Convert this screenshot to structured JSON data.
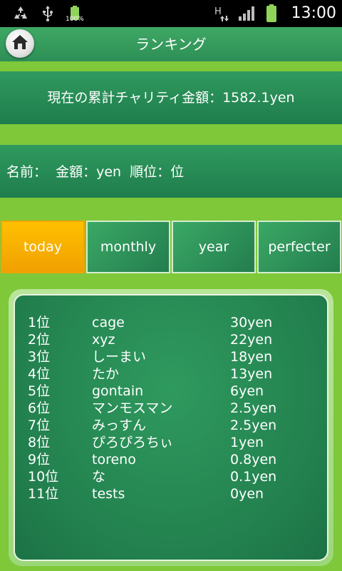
{
  "status_bar": {
    "time": "13:00",
    "battery_percent": "100%",
    "icons": [
      "recycle-icon",
      "usb-icon",
      "battery-icon",
      "hspa-icon",
      "signal-icon",
      "battery-icon"
    ]
  },
  "header": {
    "title": "ランキング"
  },
  "total": {
    "text": "現在の累計チャリティ金額：1582.1yen"
  },
  "user": {
    "text": "名前：  金額：yen  順位：位"
  },
  "tabs": [
    {
      "label": "today",
      "active": true
    },
    {
      "label": "monthly",
      "active": false
    },
    {
      "label": "year",
      "active": false
    },
    {
      "label": "perfecter",
      "active": false
    }
  ],
  "ranking": [
    {
      "rank": "1位",
      "name": "cage",
      "amount": "30yen"
    },
    {
      "rank": "2位",
      "name": "xyz",
      "amount": "22yen"
    },
    {
      "rank": "3位",
      "name": "しーまい",
      "amount": "18yen"
    },
    {
      "rank": "4位",
      "name": "たか",
      "amount": "13yen"
    },
    {
      "rank": "5位",
      "name": "gontain",
      "amount": "6yen"
    },
    {
      "rank": "6位",
      "name": "マンモスマン",
      "amount": "2.5yen"
    },
    {
      "rank": "7位",
      "name": "みっすん",
      "amount": "2.5yen"
    },
    {
      "rank": "8位",
      "name": "ぴろぴろちぃ",
      "amount": "1yen"
    },
    {
      "rank": "9位",
      "name": "toreno",
      "amount": "0.8yen"
    },
    {
      "rank": "10位",
      "name": "な",
      "amount": "0.1yen"
    },
    {
      "rank": "11位",
      "name": "tests",
      "amount": "0yen"
    }
  ]
}
